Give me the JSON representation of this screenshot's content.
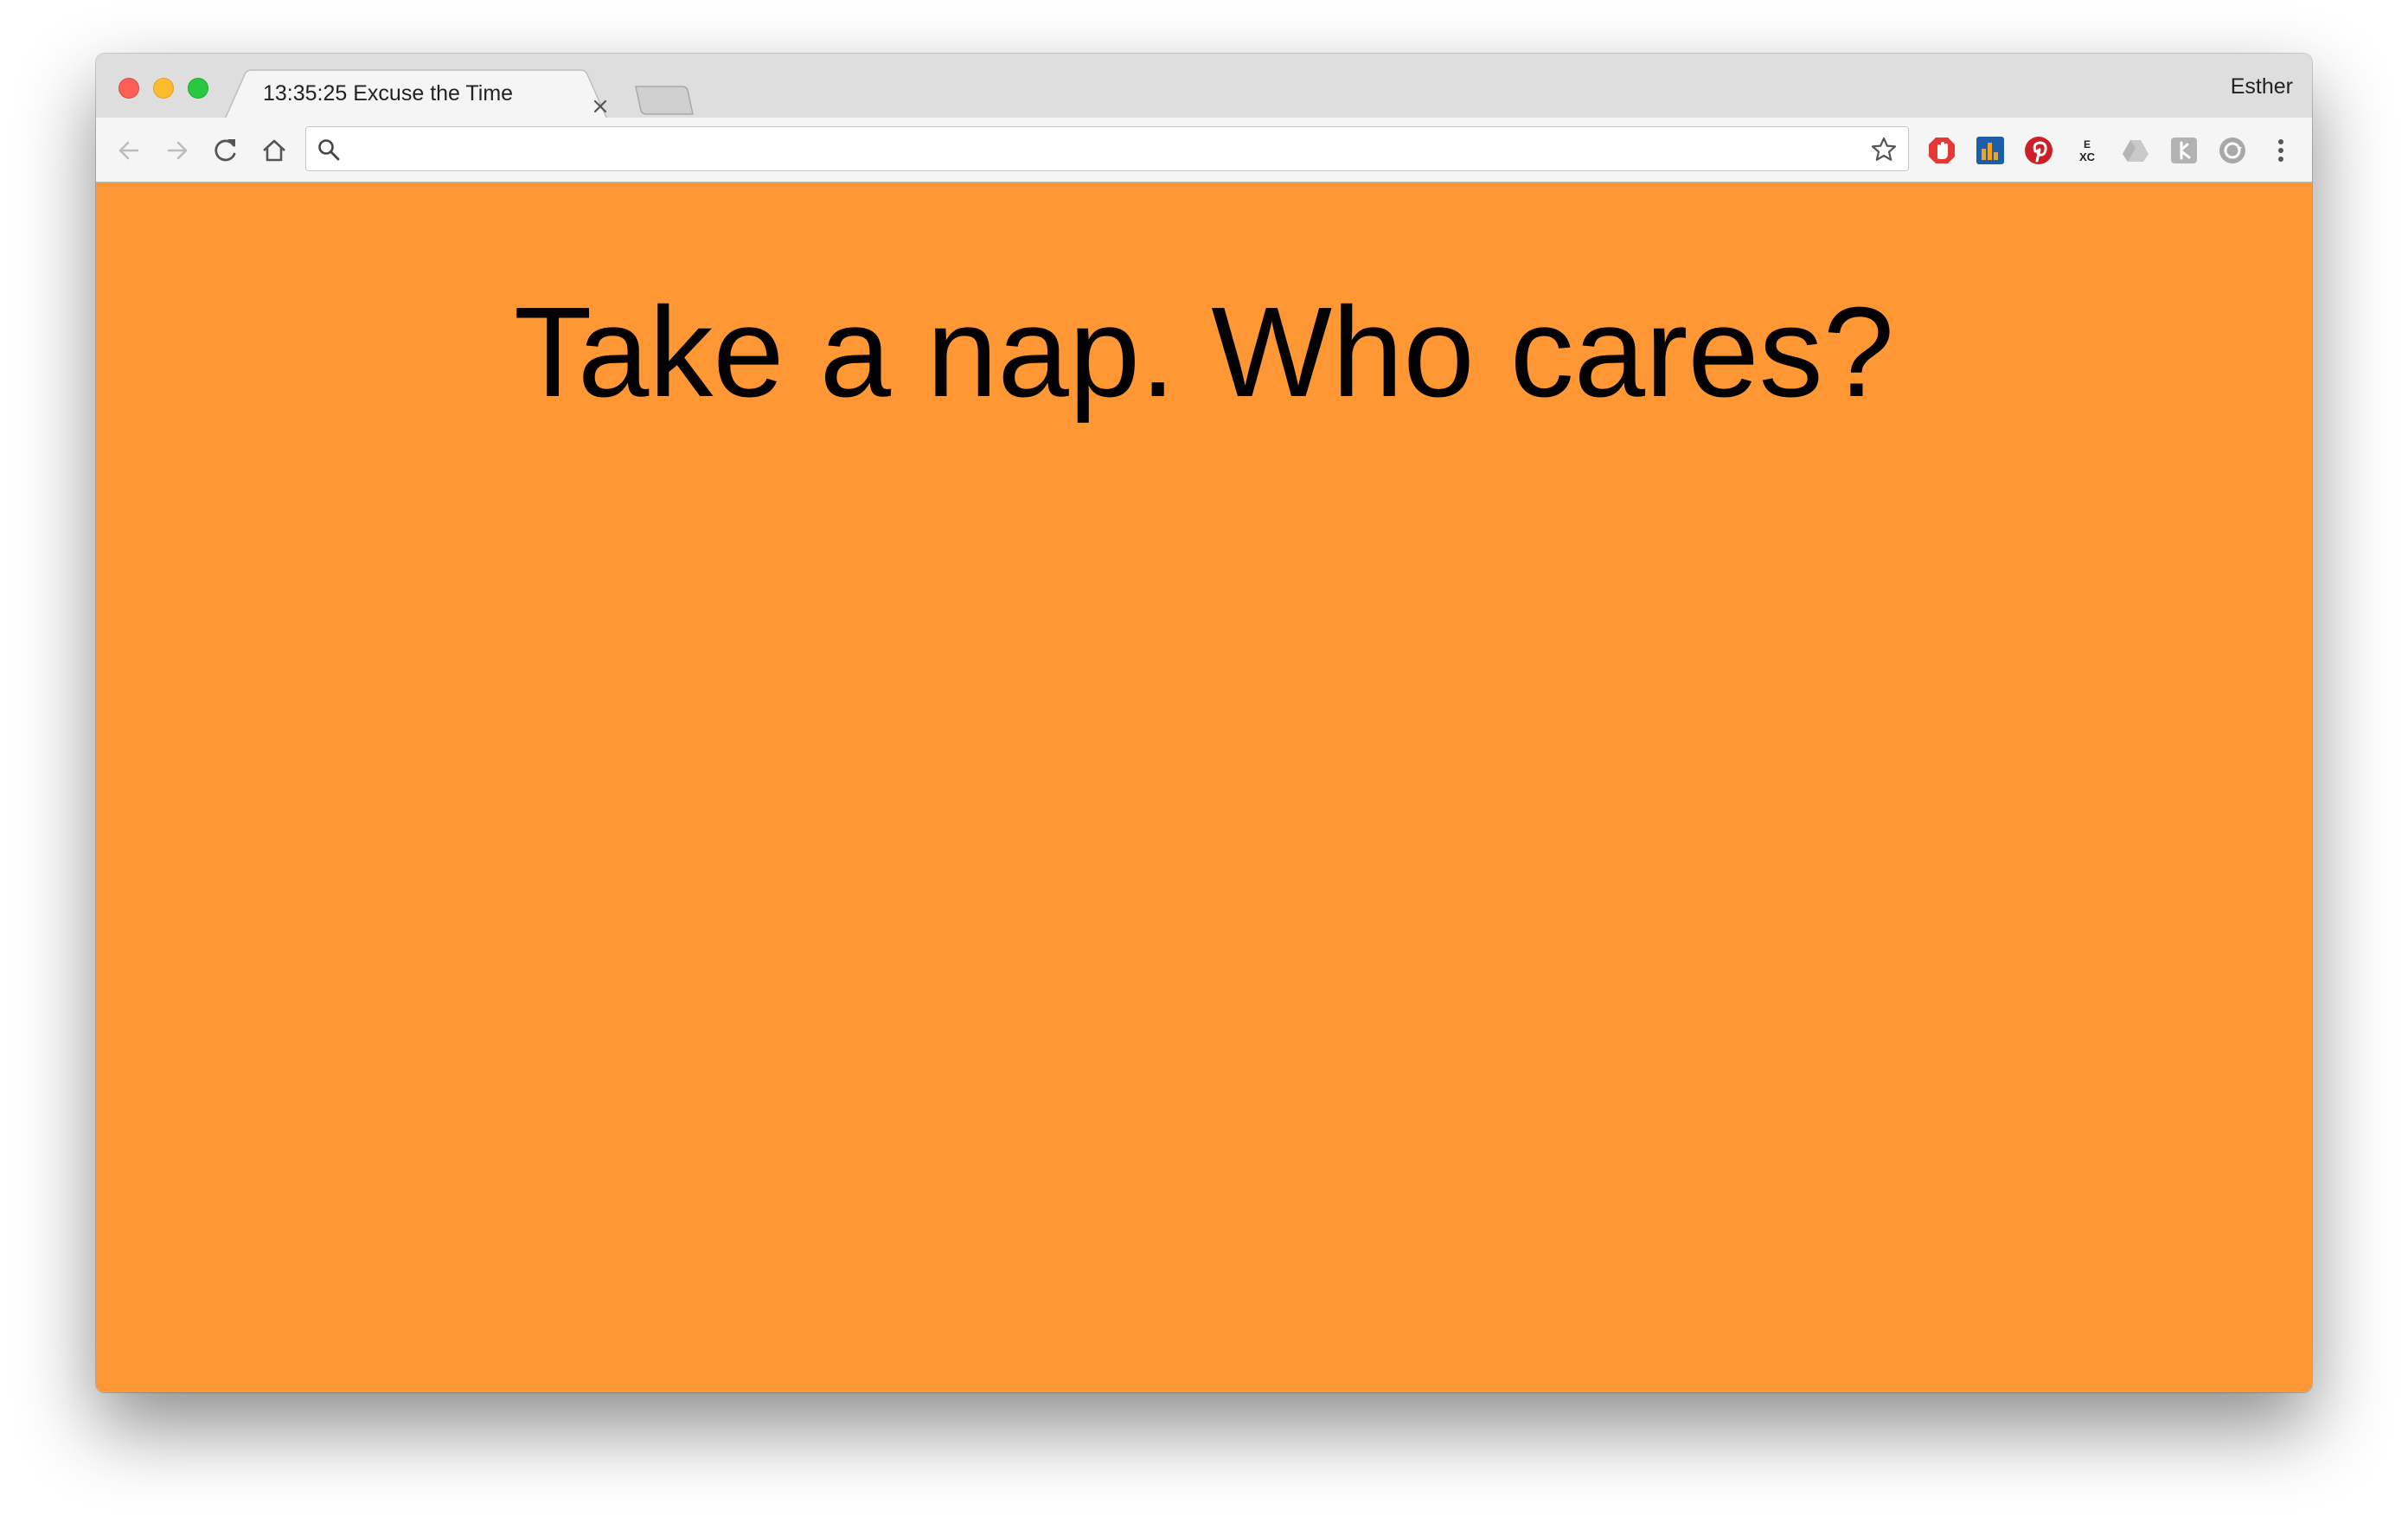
{
  "browser": {
    "tab": {
      "title": "13:35:25 Excuse the Time"
    },
    "profile_name": "Esther",
    "address_bar": {
      "value": "",
      "placeholder": ""
    },
    "extensions": [
      "adblock-icon",
      "analytics-icon",
      "pinterest-icon",
      "excel-icon",
      "drive-icon",
      "clipper-icon",
      "sync-icon"
    ]
  },
  "page": {
    "background_color": "#ff9834",
    "headline": "Take a nap. Who cares?"
  }
}
